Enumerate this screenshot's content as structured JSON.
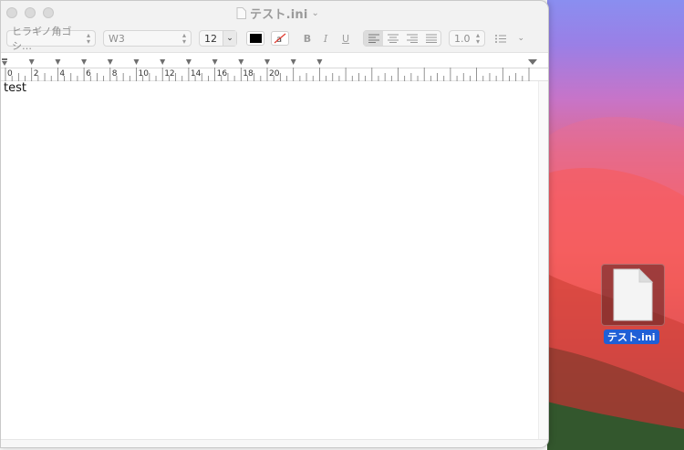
{
  "window": {
    "title": "テスト.ini",
    "title_chevron": "⌄"
  },
  "toolbar": {
    "font_family": "ヒラギノ角ゴシ…",
    "font_style": "W3",
    "font_size": "12",
    "bold_label": "B",
    "italic_label": "I",
    "underline_label": "U",
    "line_spacing": "1.0",
    "text_color": "#000000"
  },
  "ruler": {
    "labels": [
      "0",
      "2",
      "4",
      "6",
      "8",
      "10",
      "12",
      "14",
      "16",
      "18",
      "20"
    ]
  },
  "document": {
    "content": "test"
  },
  "desktop": {
    "file_label": "テスト.ini",
    "selection_color": "#1f5fd6"
  }
}
